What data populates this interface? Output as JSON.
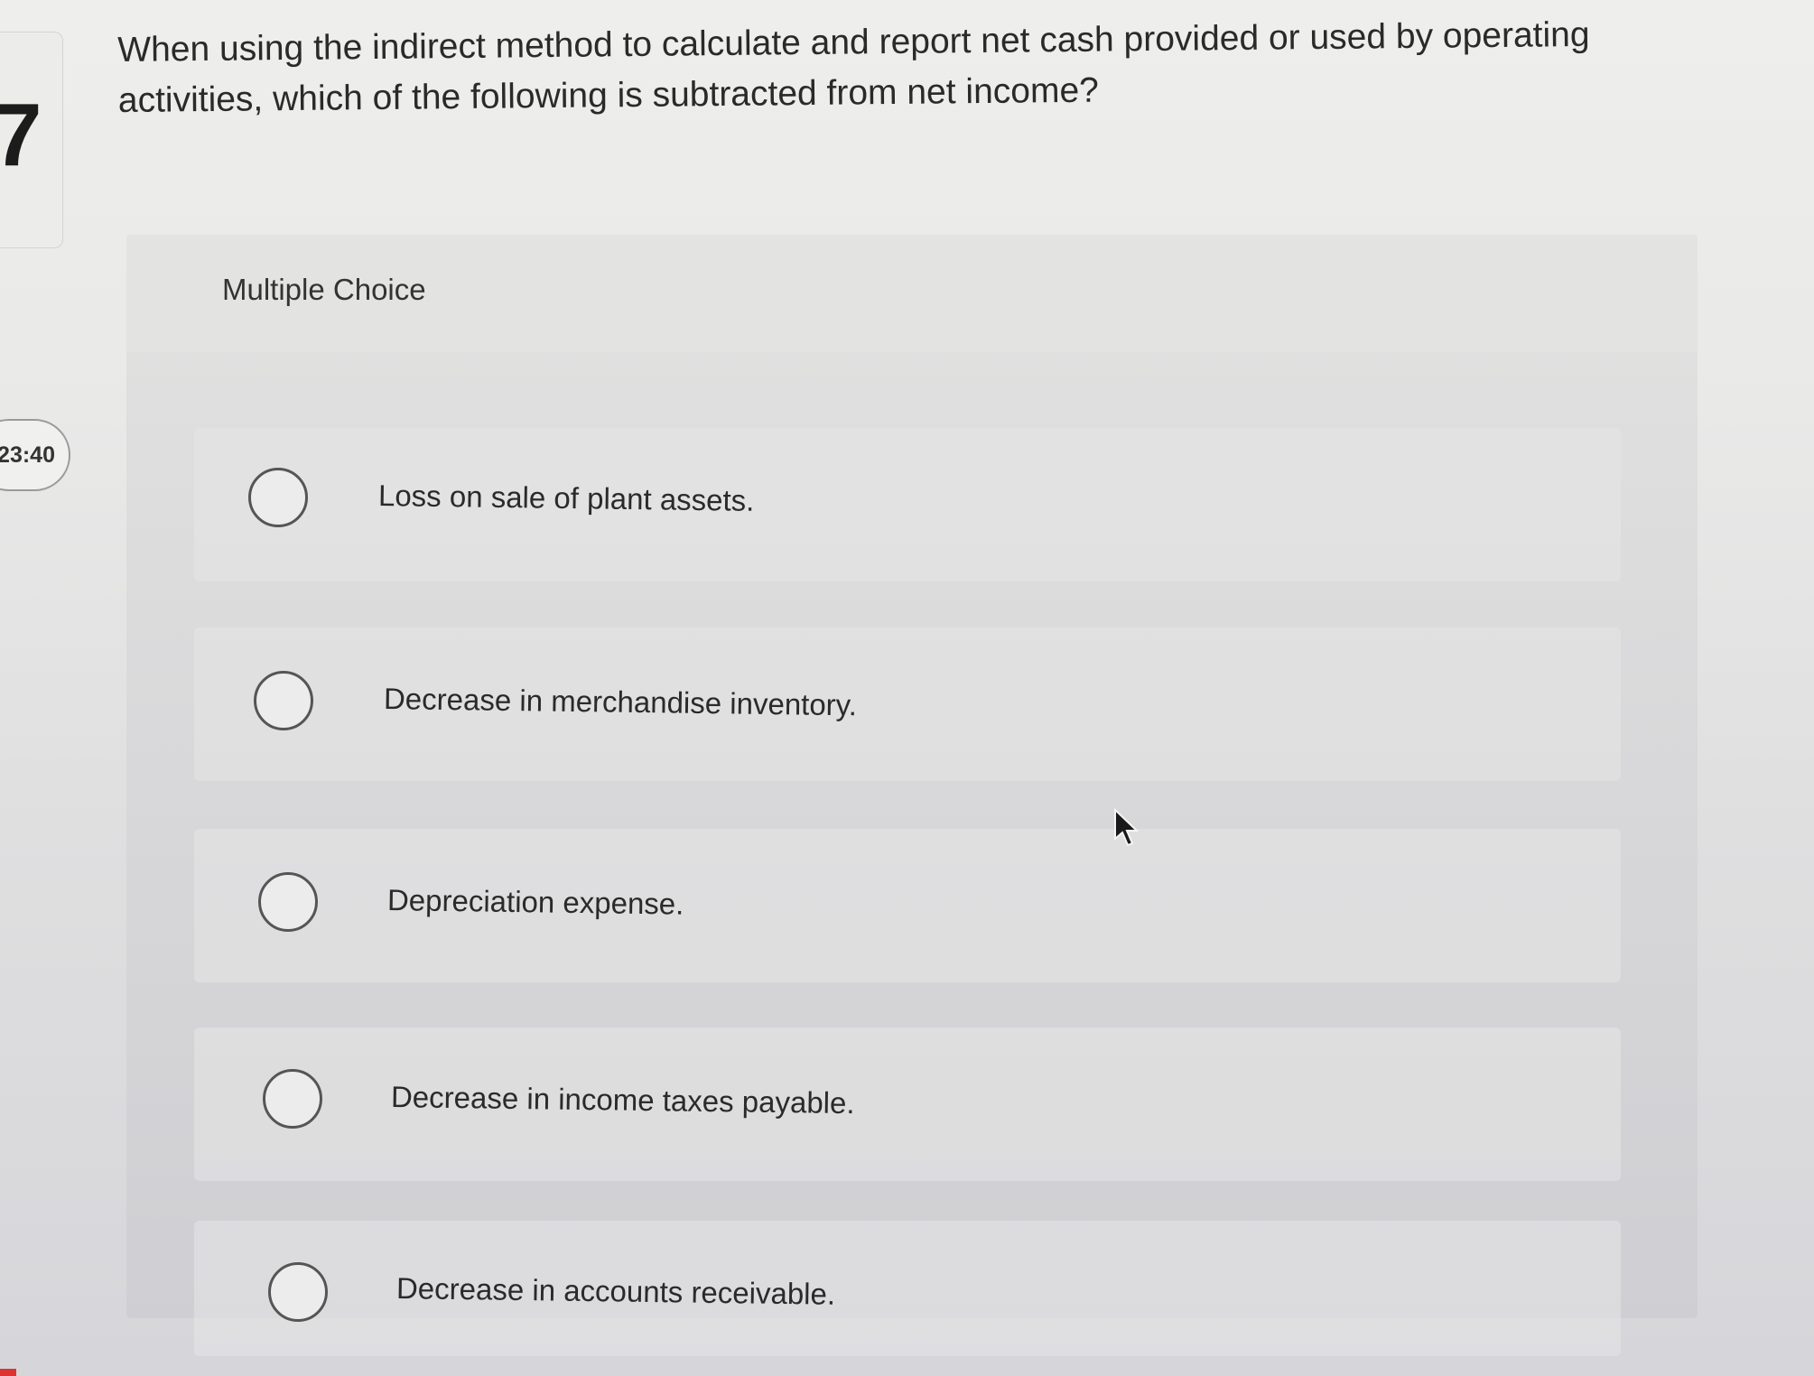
{
  "question": {
    "number": "7",
    "text": "When using the indirect method to calculate and report net cash provided or used by operating activities, which of the following is subtracted from net income?"
  },
  "timer": {
    "value": "23:40"
  },
  "multiple_choice": {
    "label": "Multiple Choice",
    "choices": [
      {
        "label": "Loss on sale of plant assets.",
        "selected": false
      },
      {
        "label": "Decrease in merchandise inventory.",
        "selected": false
      },
      {
        "label": "Depreciation expense.",
        "selected": false
      },
      {
        "label": "Decrease in income taxes payable.",
        "selected": false
      },
      {
        "label": "Decrease in accounts receivable.",
        "selected": false
      }
    ]
  },
  "icons": {
    "cursor": "mouse-pointer-icon",
    "radio": "radio-unchecked-icon"
  }
}
